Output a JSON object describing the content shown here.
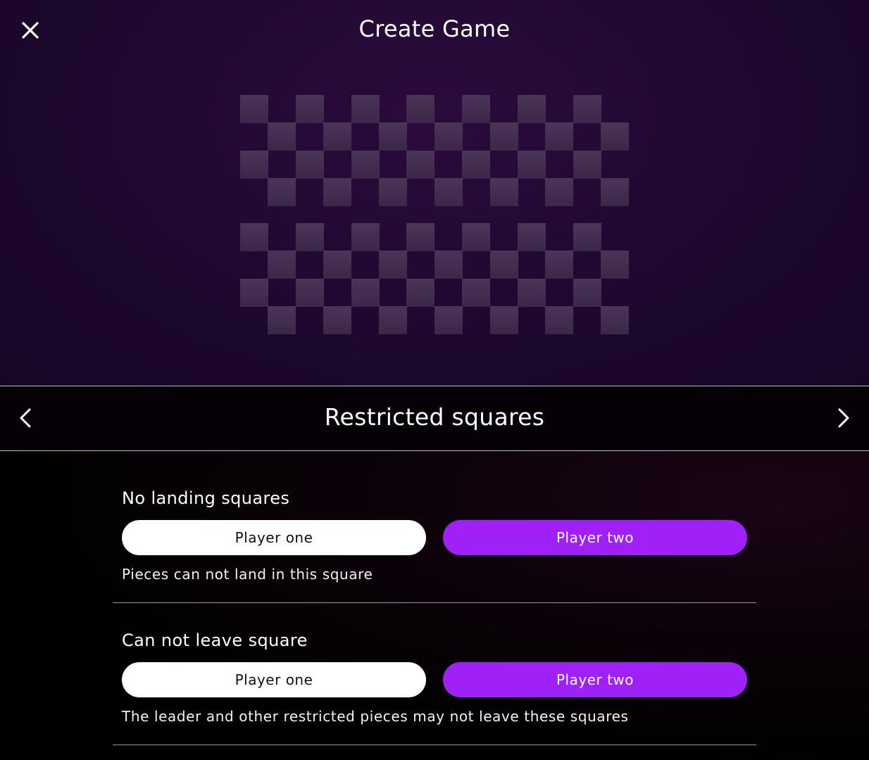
{
  "header": {
    "title": "Create Game",
    "close_icon": "close-icon"
  },
  "board_preview": {
    "square_color": "#4a3558",
    "background_color": "#1e0830"
  },
  "nav": {
    "title": "Restricted squares",
    "prev_icon": "chevron-left-icon",
    "next_icon": "chevron-right-icon"
  },
  "sections": [
    {
      "label": "No landing squares",
      "options": [
        "Player one",
        "Player two"
      ],
      "selected": "Player two",
      "description": "Pieces can not land in this square"
    },
    {
      "label": "Can not leave square",
      "options": [
        "Player one",
        "Player two"
      ],
      "selected": "Player two",
      "description": "The leader and other restricted pieces may not leave these squares"
    }
  ],
  "colors": {
    "accent": "#a020f8",
    "pill_unselected": "#ffffff",
    "text": "#ffffff"
  }
}
